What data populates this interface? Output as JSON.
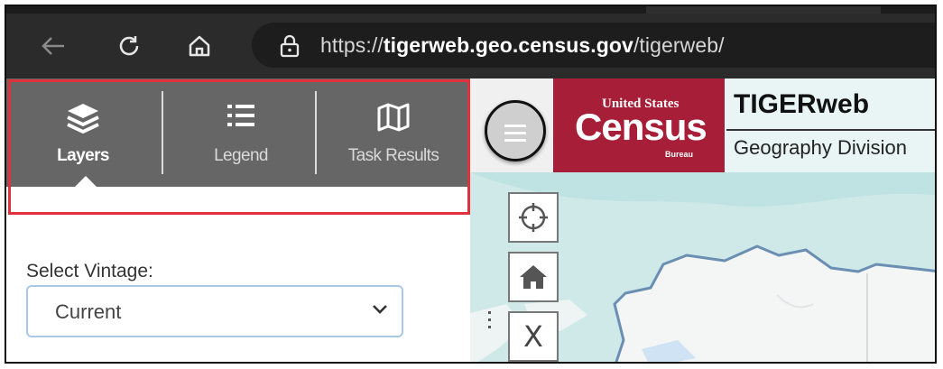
{
  "browser": {
    "url_scheme": "https://",
    "url_domain": "tigerweb.geo.census.gov",
    "url_path": "/tigerweb/"
  },
  "panel": {
    "tabs": [
      {
        "label": "Layers",
        "icon": "layers-icon",
        "active": true
      },
      {
        "label": "Legend",
        "icon": "list-icon",
        "active": false
      },
      {
        "label": "Task Results",
        "icon": "map-icon",
        "active": false
      }
    ],
    "vintage_label": "Select Vintage:",
    "vintage_value": "Current"
  },
  "header": {
    "logo_top": "United States",
    "logo_main": "Census",
    "logo_bottom": "Bureau",
    "title": "TIGERweb",
    "subtitle": "Geography Division"
  },
  "map_controls": {
    "locate_icon": "crosshair-icon",
    "home_icon": "home-icon",
    "clear_label": "X"
  },
  "colors": {
    "census_red": "#a61e37",
    "tab_gray": "#666666",
    "highlight_red": "#e0323a"
  }
}
